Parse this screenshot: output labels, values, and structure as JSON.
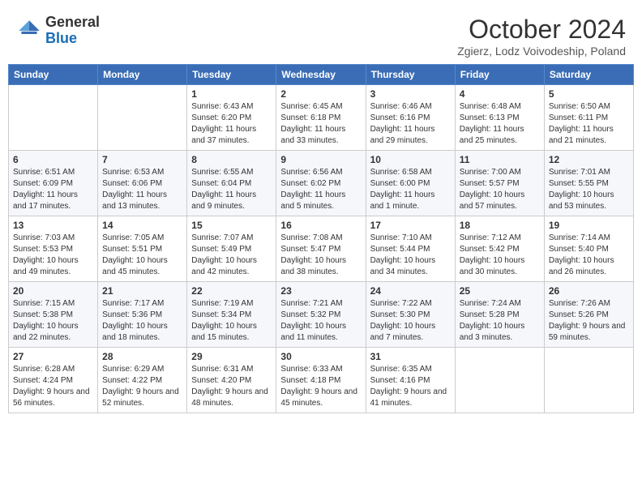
{
  "header": {
    "logo_line1": "General",
    "logo_line2": "Blue",
    "month": "October 2024",
    "location": "Zgierz, Lodz Voivodeship, Poland"
  },
  "weekdays": [
    "Sunday",
    "Monday",
    "Tuesday",
    "Wednesday",
    "Thursday",
    "Friday",
    "Saturday"
  ],
  "weeks": [
    [
      {
        "day": "",
        "info": ""
      },
      {
        "day": "",
        "info": ""
      },
      {
        "day": "1",
        "info": "Sunrise: 6:43 AM\nSunset: 6:20 PM\nDaylight: 11 hours and 37 minutes."
      },
      {
        "day": "2",
        "info": "Sunrise: 6:45 AM\nSunset: 6:18 PM\nDaylight: 11 hours and 33 minutes."
      },
      {
        "day": "3",
        "info": "Sunrise: 6:46 AM\nSunset: 6:16 PM\nDaylight: 11 hours and 29 minutes."
      },
      {
        "day": "4",
        "info": "Sunrise: 6:48 AM\nSunset: 6:13 PM\nDaylight: 11 hours and 25 minutes."
      },
      {
        "day": "5",
        "info": "Sunrise: 6:50 AM\nSunset: 6:11 PM\nDaylight: 11 hours and 21 minutes."
      }
    ],
    [
      {
        "day": "6",
        "info": "Sunrise: 6:51 AM\nSunset: 6:09 PM\nDaylight: 11 hours and 17 minutes."
      },
      {
        "day": "7",
        "info": "Sunrise: 6:53 AM\nSunset: 6:06 PM\nDaylight: 11 hours and 13 minutes."
      },
      {
        "day": "8",
        "info": "Sunrise: 6:55 AM\nSunset: 6:04 PM\nDaylight: 11 hours and 9 minutes."
      },
      {
        "day": "9",
        "info": "Sunrise: 6:56 AM\nSunset: 6:02 PM\nDaylight: 11 hours and 5 minutes."
      },
      {
        "day": "10",
        "info": "Sunrise: 6:58 AM\nSunset: 6:00 PM\nDaylight: 11 hours and 1 minute."
      },
      {
        "day": "11",
        "info": "Sunrise: 7:00 AM\nSunset: 5:57 PM\nDaylight: 10 hours and 57 minutes."
      },
      {
        "day": "12",
        "info": "Sunrise: 7:01 AM\nSunset: 5:55 PM\nDaylight: 10 hours and 53 minutes."
      }
    ],
    [
      {
        "day": "13",
        "info": "Sunrise: 7:03 AM\nSunset: 5:53 PM\nDaylight: 10 hours and 49 minutes."
      },
      {
        "day": "14",
        "info": "Sunrise: 7:05 AM\nSunset: 5:51 PM\nDaylight: 10 hours and 45 minutes."
      },
      {
        "day": "15",
        "info": "Sunrise: 7:07 AM\nSunset: 5:49 PM\nDaylight: 10 hours and 42 minutes."
      },
      {
        "day": "16",
        "info": "Sunrise: 7:08 AM\nSunset: 5:47 PM\nDaylight: 10 hours and 38 minutes."
      },
      {
        "day": "17",
        "info": "Sunrise: 7:10 AM\nSunset: 5:44 PM\nDaylight: 10 hours and 34 minutes."
      },
      {
        "day": "18",
        "info": "Sunrise: 7:12 AM\nSunset: 5:42 PM\nDaylight: 10 hours and 30 minutes."
      },
      {
        "day": "19",
        "info": "Sunrise: 7:14 AM\nSunset: 5:40 PM\nDaylight: 10 hours and 26 minutes."
      }
    ],
    [
      {
        "day": "20",
        "info": "Sunrise: 7:15 AM\nSunset: 5:38 PM\nDaylight: 10 hours and 22 minutes."
      },
      {
        "day": "21",
        "info": "Sunrise: 7:17 AM\nSunset: 5:36 PM\nDaylight: 10 hours and 18 minutes."
      },
      {
        "day": "22",
        "info": "Sunrise: 7:19 AM\nSunset: 5:34 PM\nDaylight: 10 hours and 15 minutes."
      },
      {
        "day": "23",
        "info": "Sunrise: 7:21 AM\nSunset: 5:32 PM\nDaylight: 10 hours and 11 minutes."
      },
      {
        "day": "24",
        "info": "Sunrise: 7:22 AM\nSunset: 5:30 PM\nDaylight: 10 hours and 7 minutes."
      },
      {
        "day": "25",
        "info": "Sunrise: 7:24 AM\nSunset: 5:28 PM\nDaylight: 10 hours and 3 minutes."
      },
      {
        "day": "26",
        "info": "Sunrise: 7:26 AM\nSunset: 5:26 PM\nDaylight: 9 hours and 59 minutes."
      }
    ],
    [
      {
        "day": "27",
        "info": "Sunrise: 6:28 AM\nSunset: 4:24 PM\nDaylight: 9 hours and 56 minutes."
      },
      {
        "day": "28",
        "info": "Sunrise: 6:29 AM\nSunset: 4:22 PM\nDaylight: 9 hours and 52 minutes."
      },
      {
        "day": "29",
        "info": "Sunrise: 6:31 AM\nSunset: 4:20 PM\nDaylight: 9 hours and 48 minutes."
      },
      {
        "day": "30",
        "info": "Sunrise: 6:33 AM\nSunset: 4:18 PM\nDaylight: 9 hours and 45 minutes."
      },
      {
        "day": "31",
        "info": "Sunrise: 6:35 AM\nSunset: 4:16 PM\nDaylight: 9 hours and 41 minutes."
      },
      {
        "day": "",
        "info": ""
      },
      {
        "day": "",
        "info": ""
      }
    ]
  ]
}
